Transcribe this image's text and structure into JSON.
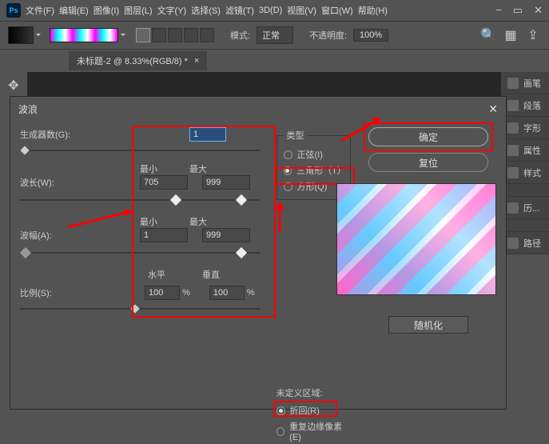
{
  "menubar": {
    "items": [
      "文件(F)",
      "编辑(E)",
      "图像(I)",
      "图层(L)",
      "文字(Y)",
      "选择(S)",
      "滤镜(T)",
      "3D(D)",
      "视图(V)",
      "窗口(W)",
      "帮助(H)"
    ]
  },
  "toolbar": {
    "mode_label": "模式:",
    "mode_value": "正常",
    "opacity_label": "不透明度:",
    "opacity_value": "100%"
  },
  "doc_tab": {
    "title": "未标题-2 @ 8.33%(RGB/8) *"
  },
  "right_panels": {
    "items": [
      "画笔",
      "段落",
      "字形",
      "属性",
      "样式",
      "",
      "历...",
      "",
      "路径"
    ]
  },
  "dialog": {
    "title": "波浪",
    "generators_label": "生成器数(G):",
    "generators_value": "1",
    "min_label": "最小",
    "max_label": "最大",
    "wavelength_label": "波长(W):",
    "wavelength_min": "705",
    "wavelength_max": "999",
    "amplitude_label": "波幅(A):",
    "amplitude_min": "1",
    "amplitude_max": "999",
    "horiz_label": "水平",
    "vert_label": "垂直",
    "scale_label": "比例(S):",
    "scale_h": "100",
    "scale_v": "100",
    "percent": "%",
    "type_legend": "类型",
    "type_sine": "正弦(I)",
    "type_triangle": "三角形（T）",
    "type_square": "方形(Q)",
    "undef_legend": "未定义区域:",
    "undef_wrap": "折回(R)",
    "undef_repeat": "重复边缘像素(E)",
    "ok": "确定",
    "reset": "复位",
    "randomize": "随机化"
  }
}
